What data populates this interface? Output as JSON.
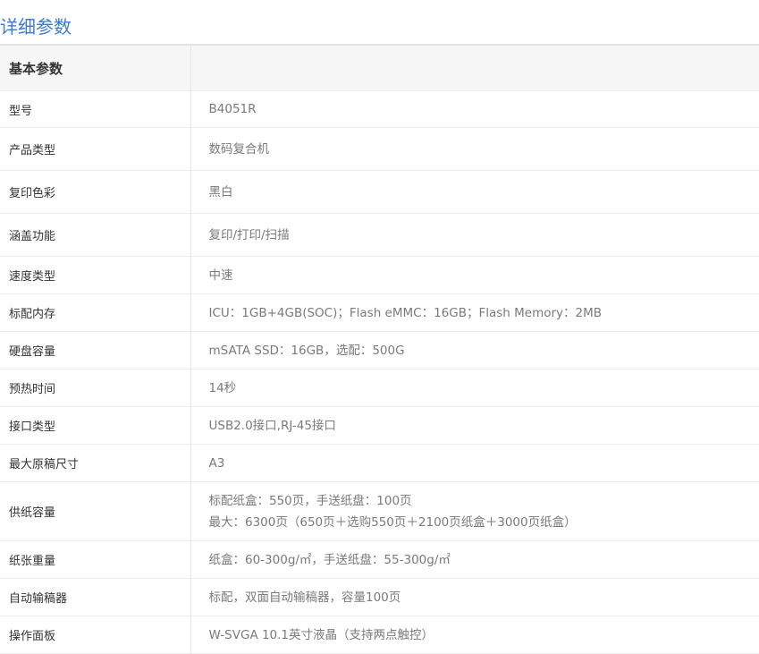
{
  "page_title": "详细参数",
  "section": "基本参数",
  "rows": [
    {
      "key": "型号",
      "value": [
        "B4051R"
      ]
    },
    {
      "key": "产品类型",
      "value": [
        "数码复合机"
      ]
    },
    {
      "key": "复印色彩",
      "value": [
        "黑白"
      ]
    },
    {
      "key": "涵盖功能",
      "value": [
        "复印/打印/扫描"
      ]
    },
    {
      "key": "速度类型",
      "value": [
        "中速"
      ]
    },
    {
      "key": "标配内存",
      "value": [
        "ICU：1GB+4GB(SOC)；Flash eMMC：16GB；Flash Memory：2MB"
      ]
    },
    {
      "key": "硬盘容量",
      "value": [
        "mSATA SSD：16GB，选配：500G"
      ]
    },
    {
      "key": "预热时间",
      "value": [
        "14秒"
      ]
    },
    {
      "key": "接口类型",
      "value": [
        "USB2.0接口,RJ-45接口"
      ]
    },
    {
      "key": "最大原稿尺寸",
      "value": [
        "A3"
      ]
    },
    {
      "key": "供纸容量",
      "value": [
        "标配纸盒：550页，手送纸盘：100页",
        "最大：6300页（650页＋选购550页＋2100页纸盒＋3000页纸盒）"
      ]
    },
    {
      "key": "纸张重量",
      "value": [
        "纸盒：60-300g/㎡，手送纸盘：55-300g/㎡"
      ]
    },
    {
      "key": "自动输稿器",
      "value": [
        "标配，双面自动输稿器，容量100页"
      ]
    },
    {
      "key": "操作面板",
      "value": [
        "W-SVGA 10.1英寸液晶（支持两点触控）"
      ]
    }
  ]
}
